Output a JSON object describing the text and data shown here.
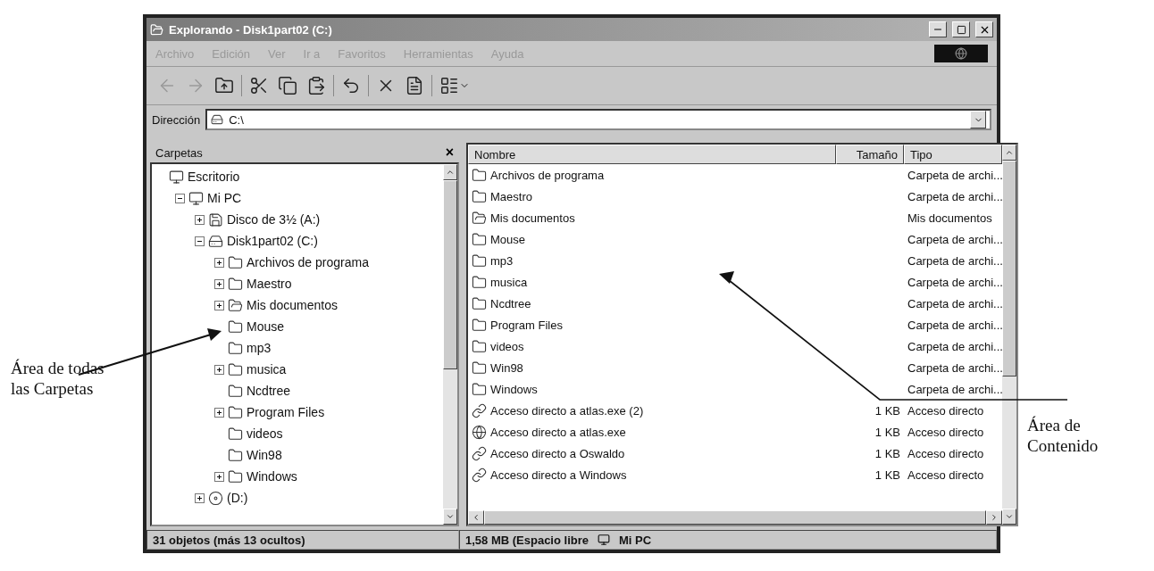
{
  "window": {
    "title": "Explorando - Disk1part02 (C:)"
  },
  "menu": [
    "Archivo",
    "Edición",
    "Ver",
    "Ir a",
    "Favoritos",
    "Herramientas",
    "Ayuda"
  ],
  "toolbar": [
    {
      "kind": "back",
      "disabled": true
    },
    {
      "kind": "forward",
      "disabled": true
    },
    {
      "kind": "up",
      "disabled": false
    },
    {
      "kind": "cut",
      "disabled": false
    },
    {
      "kind": "copy",
      "disabled": false
    },
    {
      "kind": "paste",
      "disabled": false
    },
    {
      "kind": "undo",
      "disabled": false
    },
    {
      "kind": "delete",
      "disabled": false
    },
    {
      "kind": "properties",
      "disabled": false
    },
    {
      "kind": "views",
      "disabled": false
    }
  ],
  "address": {
    "label": "Dirección",
    "value": "C:\\"
  },
  "folders": {
    "title": "Carpetas",
    "close": "×",
    "tree": [
      {
        "label": "Escritorio",
        "kind": "desktop",
        "children": [
          {
            "label": "Mi PC",
            "kind": "computer",
            "expandable": true,
            "expanded": true,
            "children": [
              {
                "label": "Disco de 3½ (A:)",
                "kind": "floppy",
                "expandable": true,
                "expanded": false
              },
              {
                "label": "Disk1part02 (C:)",
                "kind": "drive",
                "expandable": true,
                "expanded": true,
                "children": [
                  {
                    "label": "Archivos de programa",
                    "kind": "folder",
                    "expandable": true,
                    "expanded": false
                  },
                  {
                    "label": "Maestro",
                    "kind": "folder",
                    "expandable": true,
                    "expanded": false
                  },
                  {
                    "label": "Mis documentos",
                    "kind": "mydocs",
                    "expandable": true,
                    "expanded": false
                  },
                  {
                    "label": "Mouse",
                    "kind": "folder",
                    "expandable": false,
                    "expanded": false
                  },
                  {
                    "label": "mp3",
                    "kind": "folder",
                    "expandable": false,
                    "expanded": false
                  },
                  {
                    "label": "musica",
                    "kind": "folder",
                    "expandable": true,
                    "expanded": false
                  },
                  {
                    "label": "Ncdtree",
                    "kind": "folder",
                    "expandable": false,
                    "expanded": false
                  },
                  {
                    "label": "Program Files",
                    "kind": "folder",
                    "expandable": true,
                    "expanded": false
                  },
                  {
                    "label": "videos",
                    "kind": "folder",
                    "expandable": false,
                    "expanded": false
                  },
                  {
                    "label": "Win98",
                    "kind": "folder",
                    "expandable": false,
                    "expanded": false
                  },
                  {
                    "label": "Windows",
                    "kind": "folder",
                    "expandable": true,
                    "expanded": false
                  }
                ]
              },
              {
                "label": "(D:)",
                "kind": "cdrom",
                "expandable": true,
                "expanded": false
              }
            ]
          }
        ]
      }
    ]
  },
  "table": {
    "columns": [
      "Nombre",
      "Tamaño",
      "Tipo"
    ],
    "rows": [
      {
        "kind": "folder",
        "name": "Archivos de programa",
        "type": "Carpeta de archi..."
      },
      {
        "kind": "folder",
        "name": "Maestro",
        "type": "Carpeta de archi..."
      },
      {
        "kind": "mydocs",
        "name": "Mis documentos",
        "type": "Mis documentos"
      },
      {
        "kind": "folder",
        "name": "Mouse",
        "type": "Carpeta de archi..."
      },
      {
        "kind": "folder",
        "name": "mp3",
        "type": "Carpeta de archi..."
      },
      {
        "kind": "folder",
        "name": "musica",
        "type": "Carpeta de archi..."
      },
      {
        "kind": "folder",
        "name": "Ncdtree",
        "type": "Carpeta de archi..."
      },
      {
        "kind": "folder",
        "name": "Program Files",
        "type": "Carpeta de archi..."
      },
      {
        "kind": "folder",
        "name": "videos",
        "type": "Carpeta de archi..."
      },
      {
        "kind": "folder",
        "name": "Win98",
        "type": "Carpeta de archi..."
      },
      {
        "kind": "folder",
        "name": "Windows",
        "type": "Carpeta de archi..."
      },
      {
        "kind": "shortcut",
        "name": "Acceso directo a atlas.exe (2)",
        "size": "1 KB",
        "type": "Acceso directo"
      },
      {
        "kind": "app",
        "name": "Acceso directo a atlas.exe",
        "size": "1 KB",
        "type": "Acceso directo"
      },
      {
        "kind": "shortcut",
        "name": "Acceso directo a Oswaldo",
        "size": "1 KB",
        "type": "Acceso directo"
      },
      {
        "kind": "shortcut",
        "name": "Acceso directo a Windows",
        "size": "1 KB",
        "type": "Acceso directo"
      }
    ]
  },
  "status_bar": {
    "objects": "31 objetos (más 13 ocultos)",
    "space": "1,58 MB (Espacio libre",
    "location": "Mi PC"
  },
  "annotations": [
    "Área de todas las Carpetas",
    "Área de Contenido"
  ]
}
